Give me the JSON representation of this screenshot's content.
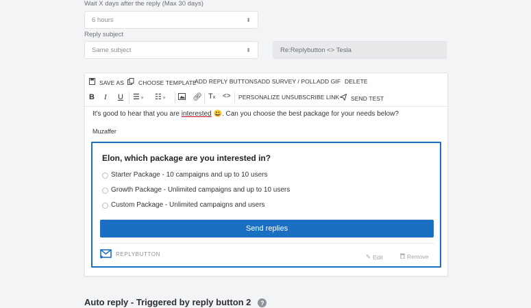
{
  "form": {
    "wait_label": "Wait X days after the reply (Max 30 days)",
    "wait_value": "6 hours",
    "subject_label": "Reply subject",
    "subject_value": "Same subject",
    "subject_preview": "Re:Replybutton <> Tesla"
  },
  "toolbar": {
    "save_as": "SAVE AS",
    "choose_template": "CHOOSE TEMPLATE",
    "add_reply_buttons": "ADD REPLY BUTTONS",
    "add_survey": "ADD SURVEY / POLL",
    "add_gif": "ADD GIF",
    "delete": "DELETE",
    "personalize": "PERSONALIZE",
    "unsubscribe_link": "UNSUBSCRIBE LINK",
    "send_test": "SEND TEST"
  },
  "message": {
    "text_before": "It's good to hear that you are ",
    "underlined_word": "interested",
    "emoji": "😃",
    "text_after": ". Can you choose the best package for your needs below?",
    "signature": "Muzaffer"
  },
  "poll": {
    "question": "Elon, which package are you interested in?",
    "options": [
      "Starter Package - 10 campaigns and up to 10 users",
      "Growth Package - Unlimited campaigns and up to 10 users",
      "Custom Package - Unlimited campaigns and users"
    ],
    "submit_label": "Send replies",
    "brand": "REPLYBUTTON",
    "edit_label": "Edit",
    "remove_label": "Remove"
  },
  "next_section": {
    "title": "Auto reply - Triggered by reply button 2",
    "help_icon": "?"
  },
  "colors": {
    "accent": "#1a6fc2",
    "background": "#f3f4f6"
  }
}
